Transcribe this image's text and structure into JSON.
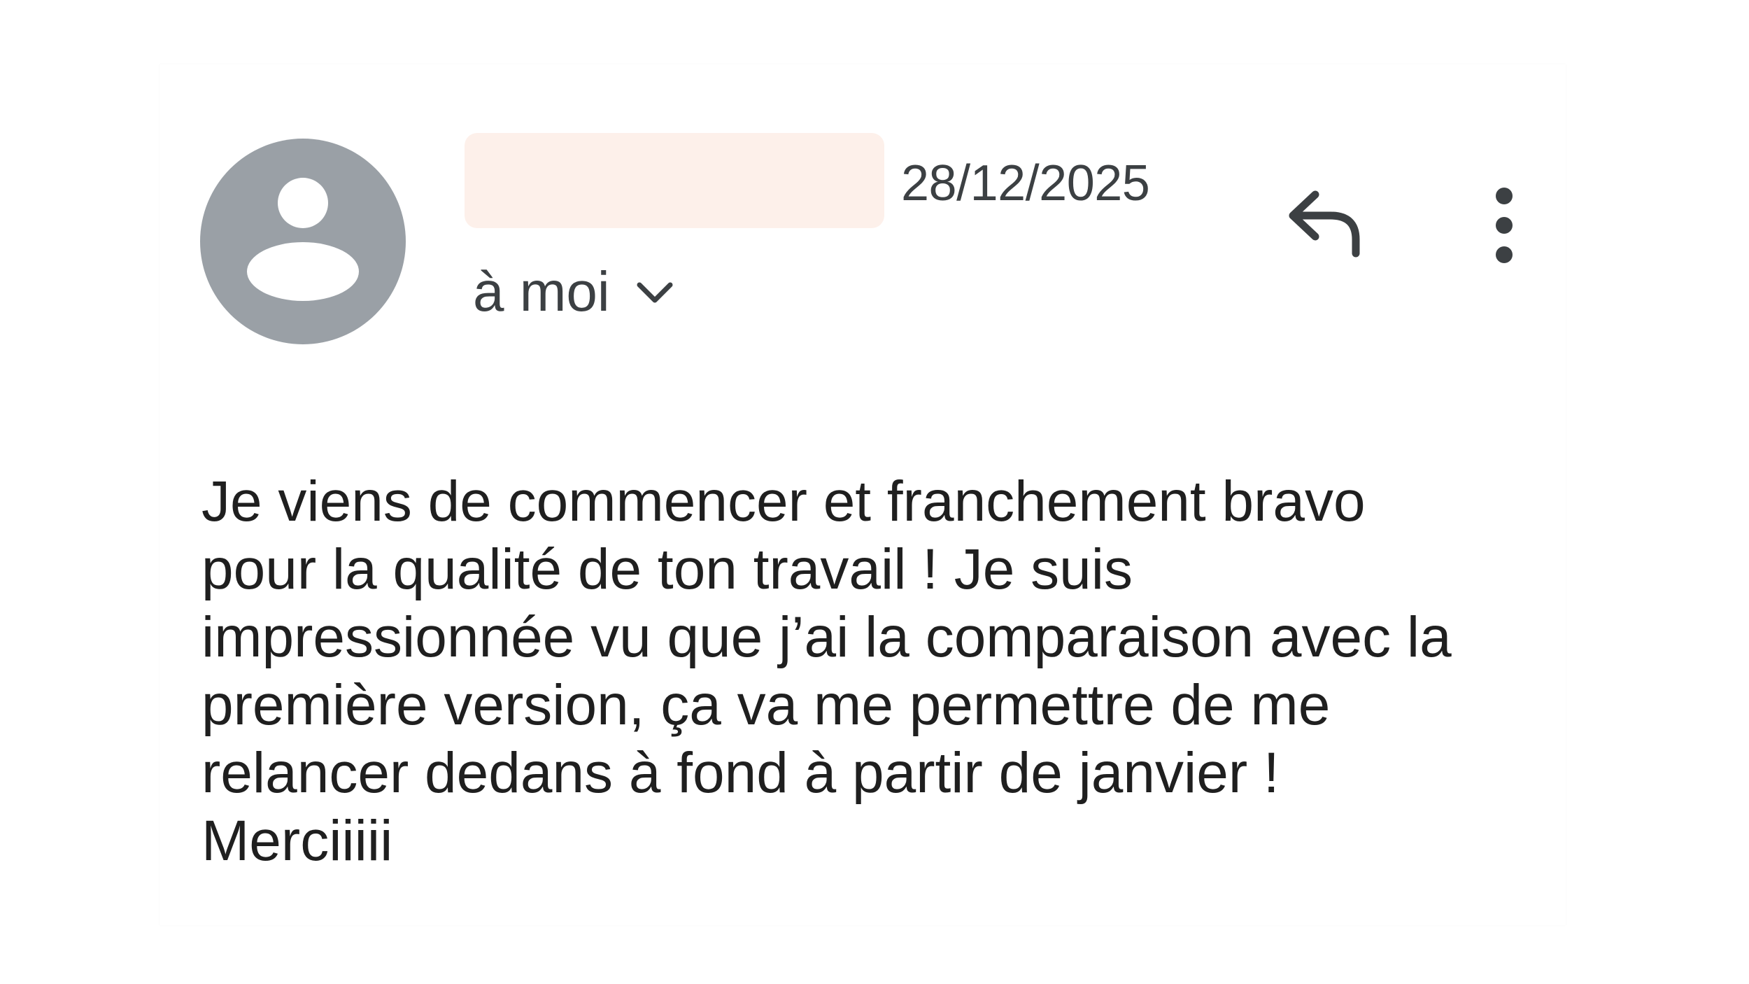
{
  "email": {
    "sender_redaction_color": "#fdf0ea",
    "date": "28/12/2025",
    "recipient_label": "à moi",
    "body_lines": [
      "Je viens de commencer et franchement bravo",
      "pour la qualité de ton travail ! Je suis",
      "impressionnée vu que j’ai la comparaison avec la",
      "première version, ça va me permettre de me",
      "relancer dedans à fond à partir de janvier !",
      "Merciiiii"
    ]
  },
  "icons": {
    "avatar": "person-avatar-icon",
    "recipient_toggle": "chevron-down-icon",
    "reply": "reply-icon",
    "more": "more-vert-icon"
  },
  "colors": {
    "avatar_bg": "#9aa0a6",
    "text_primary": "#1f1f1f",
    "text_secondary": "#3c4043",
    "icon": "#3c4043"
  }
}
